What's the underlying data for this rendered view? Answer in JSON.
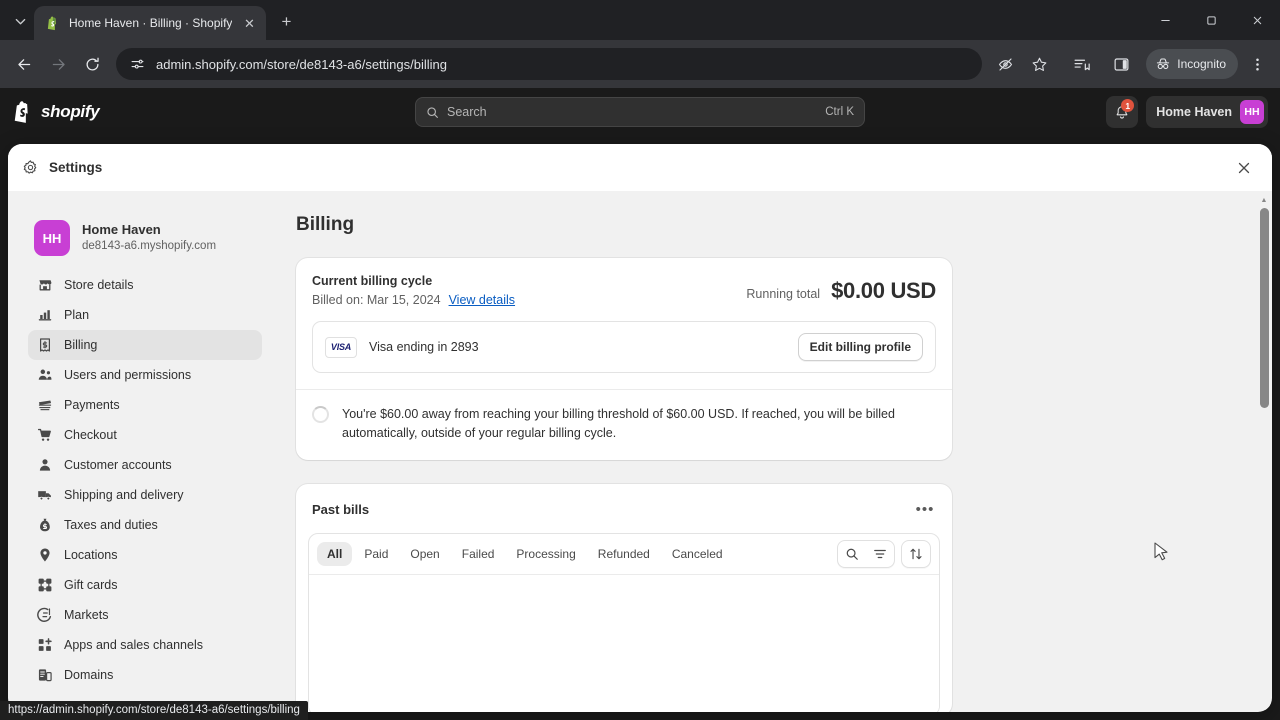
{
  "browser": {
    "tab": {
      "title": "Home Haven · Billing · Shopify",
      "favicon_name": "shopify-favicon",
      "close_label": "✕"
    },
    "new_tab_label": "+",
    "window_controls": {
      "minimize": "—",
      "maximize": "❐",
      "close": "✕"
    },
    "nav": {
      "back": "←",
      "forward": "→",
      "reload": "⟳"
    },
    "omnibox": {
      "url": "admin.shopify.com/store/de8143-a6/settings/billing",
      "site_info_icon": "page-settings-icon"
    },
    "actions": {
      "tracking_protection_icon": "eye-slash-icon",
      "bookmark_icon": "star-icon",
      "reading_list_icon": "reading-list-icon",
      "side_panel_icon": "side-panel-icon",
      "menu_icon": "three-dot-menu-icon"
    },
    "incognito_label": "Incognito",
    "status_bar_url": "https://admin.shopify.com/store/de8143-a6/settings/billing"
  },
  "topbar": {
    "brand": "shopify",
    "search": {
      "placeholder": "Search",
      "shortcut": "Ctrl K"
    },
    "notifications_count": "1",
    "account_name": "Home Haven",
    "account_initials": "HH"
  },
  "modal": {
    "title": "Settings",
    "gear_icon": "gear-icon",
    "close_label": "✕"
  },
  "sidebar": {
    "store": {
      "initials": "HH",
      "name": "Home Haven",
      "domain": "de8143-a6.myshopify.com"
    },
    "items": [
      {
        "label": "Store details",
        "icon": "store-icon",
        "active": false
      },
      {
        "label": "Plan",
        "icon": "chart-icon",
        "active": false
      },
      {
        "label": "Billing",
        "icon": "receipt-icon",
        "active": true
      },
      {
        "label": "Users and permissions",
        "icon": "users-icon",
        "active": false
      },
      {
        "label": "Payments",
        "icon": "card-icon",
        "active": false
      },
      {
        "label": "Checkout",
        "icon": "cart-icon",
        "active": false
      },
      {
        "label": "Customer accounts",
        "icon": "person-icon",
        "active": false
      },
      {
        "label": "Shipping and delivery",
        "icon": "truck-icon",
        "active": false
      },
      {
        "label": "Taxes and duties",
        "icon": "tax-icon",
        "active": false
      },
      {
        "label": "Locations",
        "icon": "pin-icon",
        "active": false
      },
      {
        "label": "Gift cards",
        "icon": "gift-card-icon",
        "active": false
      },
      {
        "label": "Markets",
        "icon": "globe-icon",
        "active": false
      },
      {
        "label": "Apps and sales channels",
        "icon": "apps-icon",
        "active": false
      },
      {
        "label": "Domains",
        "icon": "domain-icon",
        "active": false
      }
    ]
  },
  "main": {
    "page_title": "Billing",
    "billing_cycle": {
      "heading": "Current billing cycle",
      "billed_on": "Billed on: Mar 15, 2024",
      "view_details_link": "View details",
      "running_total_label": "Running total",
      "running_total_value": "$0.00 USD"
    },
    "payment_method": {
      "brand": "VISA",
      "text": "Visa ending in 2893",
      "edit_button": "Edit billing profile"
    },
    "threshold_notice": "You're $60.00 away from reaching your billing threshold of $60.00 USD. If reached, you will be billed automatically, outside of your regular billing cycle.",
    "past_bills": {
      "heading": "Past bills",
      "kebab_label": "•••",
      "tabs": [
        {
          "label": "All",
          "active": true
        },
        {
          "label": "Paid",
          "active": false
        },
        {
          "label": "Open",
          "active": false
        },
        {
          "label": "Failed",
          "active": false
        },
        {
          "label": "Processing",
          "active": false
        },
        {
          "label": "Refunded",
          "active": false
        },
        {
          "label": "Canceled",
          "active": false
        }
      ],
      "tools": {
        "search_icon": "search-icon",
        "filter_icon": "filter-icon",
        "sort_icon": "sort-icon"
      },
      "rows": []
    }
  },
  "colors": {
    "accent": "#c83fd4",
    "link": "#0a5dc2",
    "badge": "#e0533d",
    "visa_navy": "#1a1f71"
  }
}
